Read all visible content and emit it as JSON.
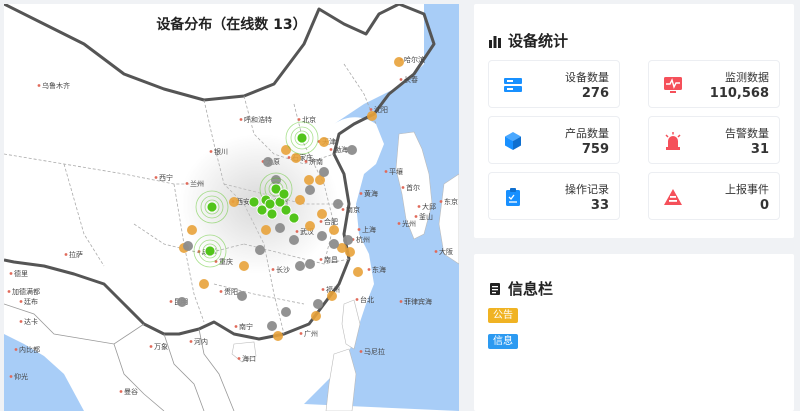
{
  "map": {
    "title": "设备分布（在线数 13）",
    "region_labels": [
      "北京",
      "天津",
      "石家庄",
      "太原",
      "济南",
      "郑州",
      "西安",
      "兰州",
      "西宁",
      "银川",
      "呼和浩特",
      "沈阳",
      "长春",
      "哈尔滨",
      "乌鲁木齐",
      "拉萨",
      "成都",
      "重庆",
      "贵阳",
      "昆明",
      "南宁",
      "广州",
      "长沙",
      "武汉",
      "南昌",
      "杭州",
      "上海",
      "南京",
      "合肥",
      "福州",
      "台北",
      "海口",
      "平壤",
      "首尔",
      "东京",
      "渤海",
      "黄海",
      "东海",
      "菲律宾海",
      "德里",
      "加德满都",
      "廷布",
      "达卡",
      "内比都",
      "仰光",
      "河内",
      "万象",
      "曼谷",
      "马尼拉",
      "大阪",
      "釜山",
      "光州",
      "大邱"
    ],
    "legend": {
      "online_color": "#52c41a",
      "warning_color": "#e8a23a",
      "offline_color": "#8c8c8c"
    }
  },
  "stats": {
    "title": "设备统计",
    "cards": [
      {
        "label": "设备数量",
        "value": "276",
        "icon": "server-icon",
        "color": "#1890ff"
      },
      {
        "label": "监测数据",
        "value": "110,568",
        "icon": "monitor-icon",
        "color": "#f5505a"
      },
      {
        "label": "产品数量",
        "value": "759",
        "icon": "cube-icon",
        "color": "#1890ff"
      },
      {
        "label": "告警数量",
        "value": "31",
        "icon": "alarm-light-icon",
        "color": "#f5505a"
      },
      {
        "label": "操作记录",
        "value": "33",
        "icon": "clipboard-icon",
        "color": "#1890ff"
      },
      {
        "label": "上报事件",
        "value": "0",
        "icon": "warning-triangle-icon",
        "color": "#f5505a"
      }
    ]
  },
  "info": {
    "title": "信息栏",
    "tags": [
      {
        "label": "公告",
        "color": "#f0b323"
      },
      {
        "label": "信息",
        "color": "#2c9af1"
      }
    ]
  }
}
